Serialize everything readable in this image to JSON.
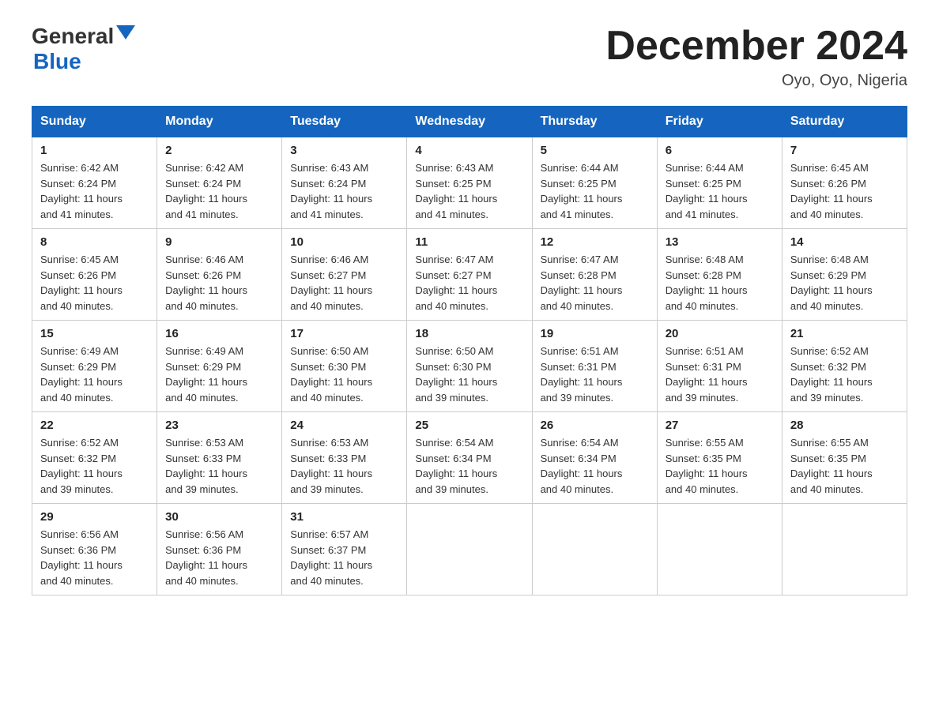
{
  "header": {
    "logo_general": "General",
    "logo_blue": "Blue",
    "month_title": "December 2024",
    "location": "Oyo, Oyo, Nigeria"
  },
  "days_of_week": [
    "Sunday",
    "Monday",
    "Tuesday",
    "Wednesday",
    "Thursday",
    "Friday",
    "Saturday"
  ],
  "weeks": [
    [
      {
        "day": "1",
        "sunrise": "6:42 AM",
        "sunset": "6:24 PM",
        "daylight": "11 hours and 41 minutes."
      },
      {
        "day": "2",
        "sunrise": "6:42 AM",
        "sunset": "6:24 PM",
        "daylight": "11 hours and 41 minutes."
      },
      {
        "day": "3",
        "sunrise": "6:43 AM",
        "sunset": "6:24 PM",
        "daylight": "11 hours and 41 minutes."
      },
      {
        "day": "4",
        "sunrise": "6:43 AM",
        "sunset": "6:25 PM",
        "daylight": "11 hours and 41 minutes."
      },
      {
        "day": "5",
        "sunrise": "6:44 AM",
        "sunset": "6:25 PM",
        "daylight": "11 hours and 41 minutes."
      },
      {
        "day": "6",
        "sunrise": "6:44 AM",
        "sunset": "6:25 PM",
        "daylight": "11 hours and 41 minutes."
      },
      {
        "day": "7",
        "sunrise": "6:45 AM",
        "sunset": "6:26 PM",
        "daylight": "11 hours and 40 minutes."
      }
    ],
    [
      {
        "day": "8",
        "sunrise": "6:45 AM",
        "sunset": "6:26 PM",
        "daylight": "11 hours and 40 minutes."
      },
      {
        "day": "9",
        "sunrise": "6:46 AM",
        "sunset": "6:26 PM",
        "daylight": "11 hours and 40 minutes."
      },
      {
        "day": "10",
        "sunrise": "6:46 AM",
        "sunset": "6:27 PM",
        "daylight": "11 hours and 40 minutes."
      },
      {
        "day": "11",
        "sunrise": "6:47 AM",
        "sunset": "6:27 PM",
        "daylight": "11 hours and 40 minutes."
      },
      {
        "day": "12",
        "sunrise": "6:47 AM",
        "sunset": "6:28 PM",
        "daylight": "11 hours and 40 minutes."
      },
      {
        "day": "13",
        "sunrise": "6:48 AM",
        "sunset": "6:28 PM",
        "daylight": "11 hours and 40 minutes."
      },
      {
        "day": "14",
        "sunrise": "6:48 AM",
        "sunset": "6:29 PM",
        "daylight": "11 hours and 40 minutes."
      }
    ],
    [
      {
        "day": "15",
        "sunrise": "6:49 AM",
        "sunset": "6:29 PM",
        "daylight": "11 hours and 40 minutes."
      },
      {
        "day": "16",
        "sunrise": "6:49 AM",
        "sunset": "6:29 PM",
        "daylight": "11 hours and 40 minutes."
      },
      {
        "day": "17",
        "sunrise": "6:50 AM",
        "sunset": "6:30 PM",
        "daylight": "11 hours and 40 minutes."
      },
      {
        "day": "18",
        "sunrise": "6:50 AM",
        "sunset": "6:30 PM",
        "daylight": "11 hours and 39 minutes."
      },
      {
        "day": "19",
        "sunrise": "6:51 AM",
        "sunset": "6:31 PM",
        "daylight": "11 hours and 39 minutes."
      },
      {
        "day": "20",
        "sunrise": "6:51 AM",
        "sunset": "6:31 PM",
        "daylight": "11 hours and 39 minutes."
      },
      {
        "day": "21",
        "sunrise": "6:52 AM",
        "sunset": "6:32 PM",
        "daylight": "11 hours and 39 minutes."
      }
    ],
    [
      {
        "day": "22",
        "sunrise": "6:52 AM",
        "sunset": "6:32 PM",
        "daylight": "11 hours and 39 minutes."
      },
      {
        "day": "23",
        "sunrise": "6:53 AM",
        "sunset": "6:33 PM",
        "daylight": "11 hours and 39 minutes."
      },
      {
        "day": "24",
        "sunrise": "6:53 AM",
        "sunset": "6:33 PM",
        "daylight": "11 hours and 39 minutes."
      },
      {
        "day": "25",
        "sunrise": "6:54 AM",
        "sunset": "6:34 PM",
        "daylight": "11 hours and 39 minutes."
      },
      {
        "day": "26",
        "sunrise": "6:54 AM",
        "sunset": "6:34 PM",
        "daylight": "11 hours and 40 minutes."
      },
      {
        "day": "27",
        "sunrise": "6:55 AM",
        "sunset": "6:35 PM",
        "daylight": "11 hours and 40 minutes."
      },
      {
        "day": "28",
        "sunrise": "6:55 AM",
        "sunset": "6:35 PM",
        "daylight": "11 hours and 40 minutes."
      }
    ],
    [
      {
        "day": "29",
        "sunrise": "6:56 AM",
        "sunset": "6:36 PM",
        "daylight": "11 hours and 40 minutes."
      },
      {
        "day": "30",
        "sunrise": "6:56 AM",
        "sunset": "6:36 PM",
        "daylight": "11 hours and 40 minutes."
      },
      {
        "day": "31",
        "sunrise": "6:57 AM",
        "sunset": "6:37 PM",
        "daylight": "11 hours and 40 minutes."
      },
      null,
      null,
      null,
      null
    ]
  ],
  "labels": {
    "sunrise": "Sunrise:",
    "sunset": "Sunset:",
    "daylight": "Daylight:"
  }
}
